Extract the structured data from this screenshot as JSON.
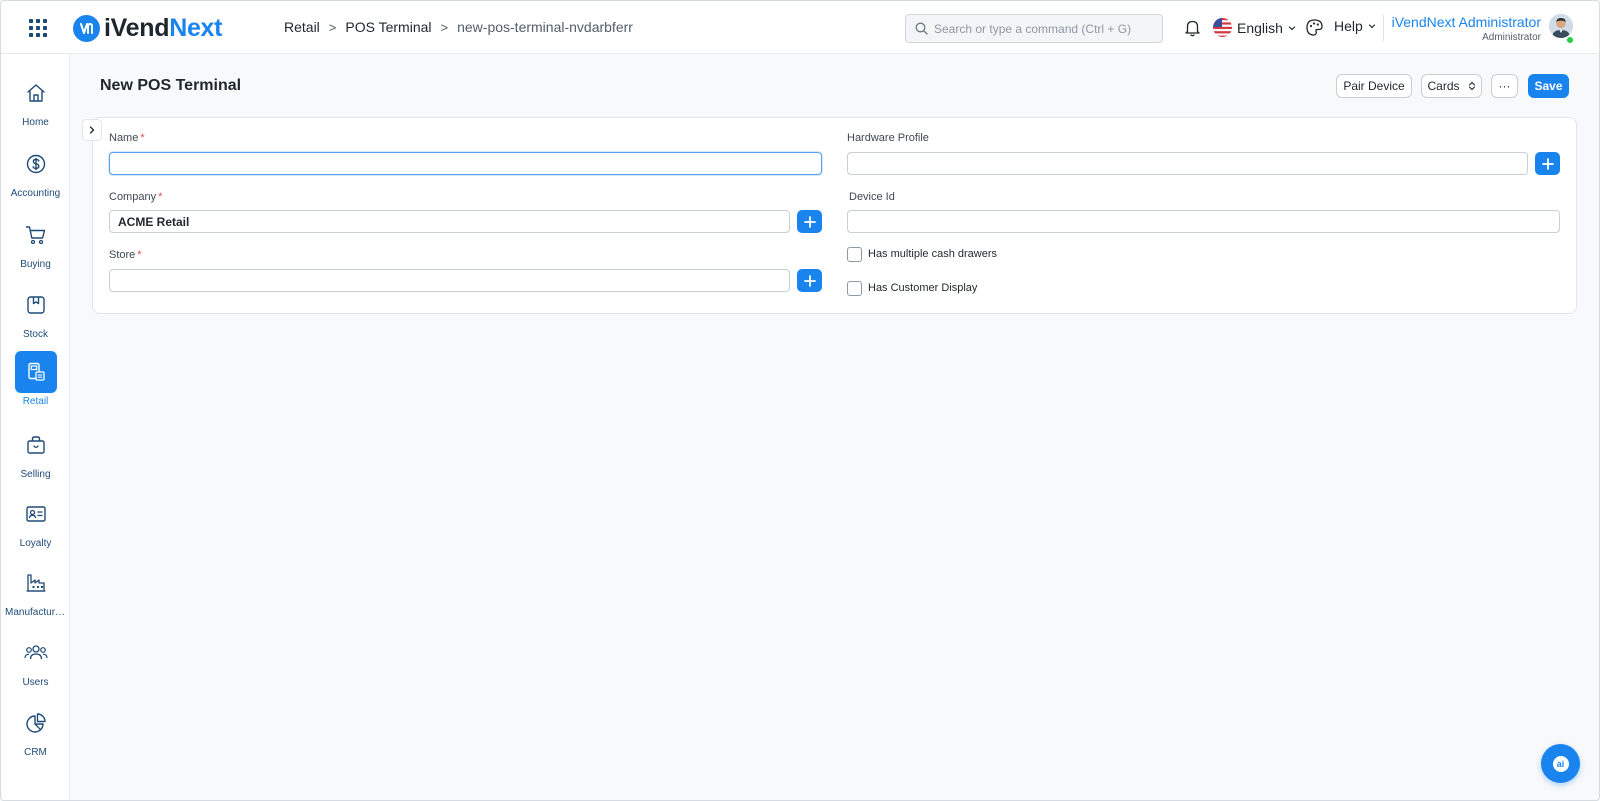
{
  "app": {
    "logo_prefix": "iVend",
    "logo_suffix": "Next"
  },
  "breadcrumb": {
    "items": [
      "Retail",
      "POS Terminal"
    ],
    "current": "new-pos-terminal-nvdarbferr"
  },
  "search": {
    "placeholder": "Search or type a command (Ctrl + G)"
  },
  "header": {
    "language": "English",
    "help": "Help",
    "user_name": "iVendNext Administrator",
    "user_role": "Administrator"
  },
  "sidebar": {
    "items": [
      {
        "label": "Home",
        "icon": "home-icon"
      },
      {
        "label": "Accounting",
        "icon": "dollar-icon"
      },
      {
        "label": "Buying",
        "icon": "cart-icon"
      },
      {
        "label": "Stock",
        "icon": "box-icon"
      },
      {
        "label": "Retail",
        "icon": "pos-icon",
        "active": true
      },
      {
        "label": "Selling",
        "icon": "bag-icon"
      },
      {
        "label": "Loyalty",
        "icon": "id-card-icon"
      },
      {
        "label": "Manufacturing",
        "icon": "factory-icon"
      },
      {
        "label": "Users",
        "icon": "users-icon"
      },
      {
        "label": "CRM",
        "icon": "pie-chart-icon"
      }
    ]
  },
  "page": {
    "title": "New POS Terminal",
    "actions": {
      "pair_device": "Pair Device",
      "cards": "Cards",
      "more": "···",
      "save": "Save"
    }
  },
  "form": {
    "name": {
      "label": "Name",
      "required": "*",
      "value": ""
    },
    "company": {
      "label": "Company",
      "required": "*",
      "value": "ACME Retail"
    },
    "store": {
      "label": "Store",
      "required": "*",
      "value": ""
    },
    "hardware_profile": {
      "label": "Hardware Profile",
      "value": ""
    },
    "device_id": {
      "label": "Device Id",
      "value": ""
    },
    "has_multiple_cash_drawers": {
      "label": "Has multiple cash drawers",
      "checked": false
    },
    "has_customer_display": {
      "label": "Has Customer Display",
      "checked": false
    }
  },
  "fab": {
    "label": "ai"
  },
  "colors": {
    "accent": "#1a84ee",
    "required": "#e24c4c"
  }
}
